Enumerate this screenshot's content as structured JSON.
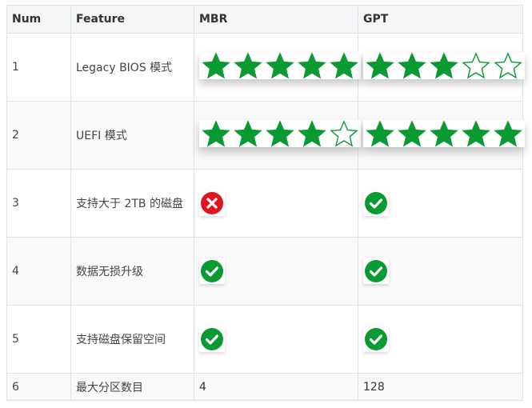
{
  "table": {
    "headers": [
      "Num",
      "Feature",
      "MBR",
      "GPT"
    ],
    "rows": [
      {
        "num": "1",
        "feature": "Legacy BIOS 模式",
        "mbr": {
          "type": "stars",
          "rating": 5,
          "max": 5
        },
        "gpt": {
          "type": "stars",
          "rating": 3,
          "max": 5
        }
      },
      {
        "num": "2",
        "feature": "UEFI 模式",
        "mbr": {
          "type": "stars",
          "rating": 4,
          "max": 5
        },
        "gpt": {
          "type": "stars",
          "rating": 5,
          "max": 5
        }
      },
      {
        "num": "3",
        "feature": "支持大于 2TB 的磁盘",
        "mbr": {
          "type": "status",
          "value": "no",
          "icon": "cross-circle-icon"
        },
        "gpt": {
          "type": "status",
          "value": "yes",
          "icon": "check-circle-icon"
        }
      },
      {
        "num": "4",
        "feature": "数据无损升级",
        "mbr": {
          "type": "status",
          "value": "yes",
          "icon": "check-circle-icon"
        },
        "gpt": {
          "type": "status",
          "value": "yes",
          "icon": "check-circle-icon"
        }
      },
      {
        "num": "5",
        "feature": "支持磁盘保留空间",
        "mbr": {
          "type": "status",
          "value": "yes",
          "icon": "check-circle-icon"
        },
        "gpt": {
          "type": "status",
          "value": "yes",
          "icon": "check-circle-icon"
        }
      },
      {
        "num": "6",
        "feature": "最大分区数目",
        "mbr": {
          "type": "text",
          "value": "4"
        },
        "gpt": {
          "type": "text",
          "value": "128"
        }
      }
    ]
  },
  "colors": {
    "star": "#0a9a32",
    "check": "#0a9a32",
    "cross": "#e0141e"
  }
}
